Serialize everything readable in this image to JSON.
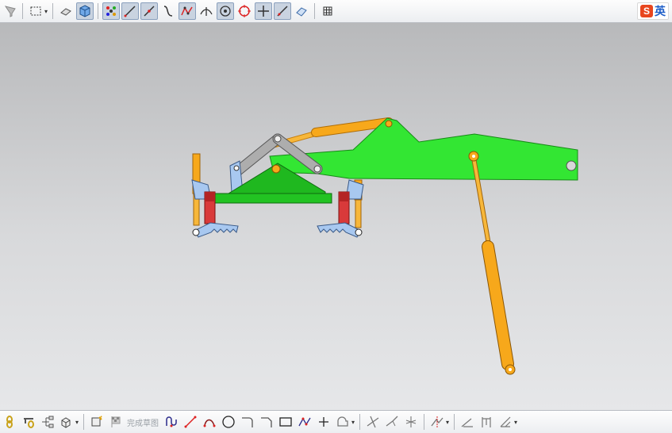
{
  "top_toolbar": {
    "icons": [
      "select-filter-icon",
      "rectangle-select-icon",
      "render-style-icon",
      "shaded-cube-icon",
      "snap-points-icon",
      "line-icon",
      "tangent-line-icon",
      "curve-icon",
      "profile-icon",
      "perpendicular-icon",
      "point-on-circle-icon",
      "circle-center-icon",
      "crosshair-icon",
      "slant-line-icon",
      "view-icon",
      "grid-icon"
    ]
  },
  "ime": {
    "logo": "S",
    "label": "英"
  },
  "bottom_toolbar": {
    "finish_sketch_label": "完成草图"
  },
  "colors": {
    "arm_green": "#33e633",
    "dark_green": "#1fb81f",
    "cylinder_orange": "#f7a81b",
    "link_gray": "#a9a9a9",
    "bracket_blue": "#a8c8f0",
    "red_part": "#d93a3a"
  }
}
